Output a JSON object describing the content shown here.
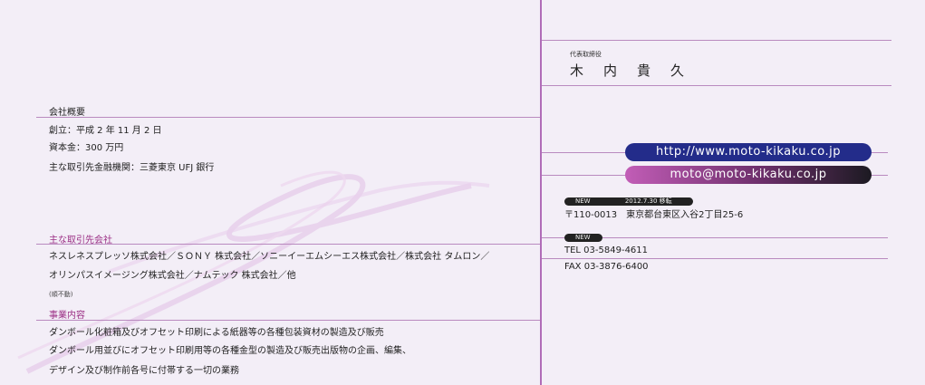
{
  "colors": {
    "background": "#f3eef7",
    "accent": "#9b2f85",
    "url_pill": "#232c8a"
  },
  "rep": {
    "title": "代表取締役",
    "name": "木内貴久"
  },
  "links": {
    "url": "http://www.moto-kikaku.co.jp",
    "email": "moto@moto-kikaku.co.jp"
  },
  "address": {
    "badge_new": "NEW",
    "relocated": "2012.7.30 移転",
    "text": "〒110-0013　東京都台東区入谷2丁目25-6"
  },
  "contact": {
    "badge_new": "NEW",
    "tel": "TEL 03-5849-4611",
    "fax": "FAX 03-3876-6400"
  },
  "overview": {
    "heading": "会社概要",
    "founded": "創立：平成 2 年 11 月 2 日",
    "capital": "資本金：300 万円",
    "bank": "主な取引先金融機関：三菱東京 UFJ 銀行"
  },
  "clients": {
    "heading": "主な取引先会社",
    "line1": "ネスレネスプレッソ株式会社／ＳＯＮＹ 株式会社／ソニーイーエムシーエス株式会社／株式会社 タムロン／",
    "line2": "オリンパスイメージング株式会社／ナムテック 株式会社／他",
    "note": "(順不動)"
  },
  "business": {
    "heading": "事業内容",
    "line1": "ダンボール化粧箱及びオフセット印刷による紙器等の各種包装資材の製造及び販売",
    "line2": "ダンボール用並びにオフセット印刷用等の各種金型の製造及び販売出版物の企画、編集、",
    "line3": "デザイン及び制作前各号に付帯する一切の業務"
  }
}
